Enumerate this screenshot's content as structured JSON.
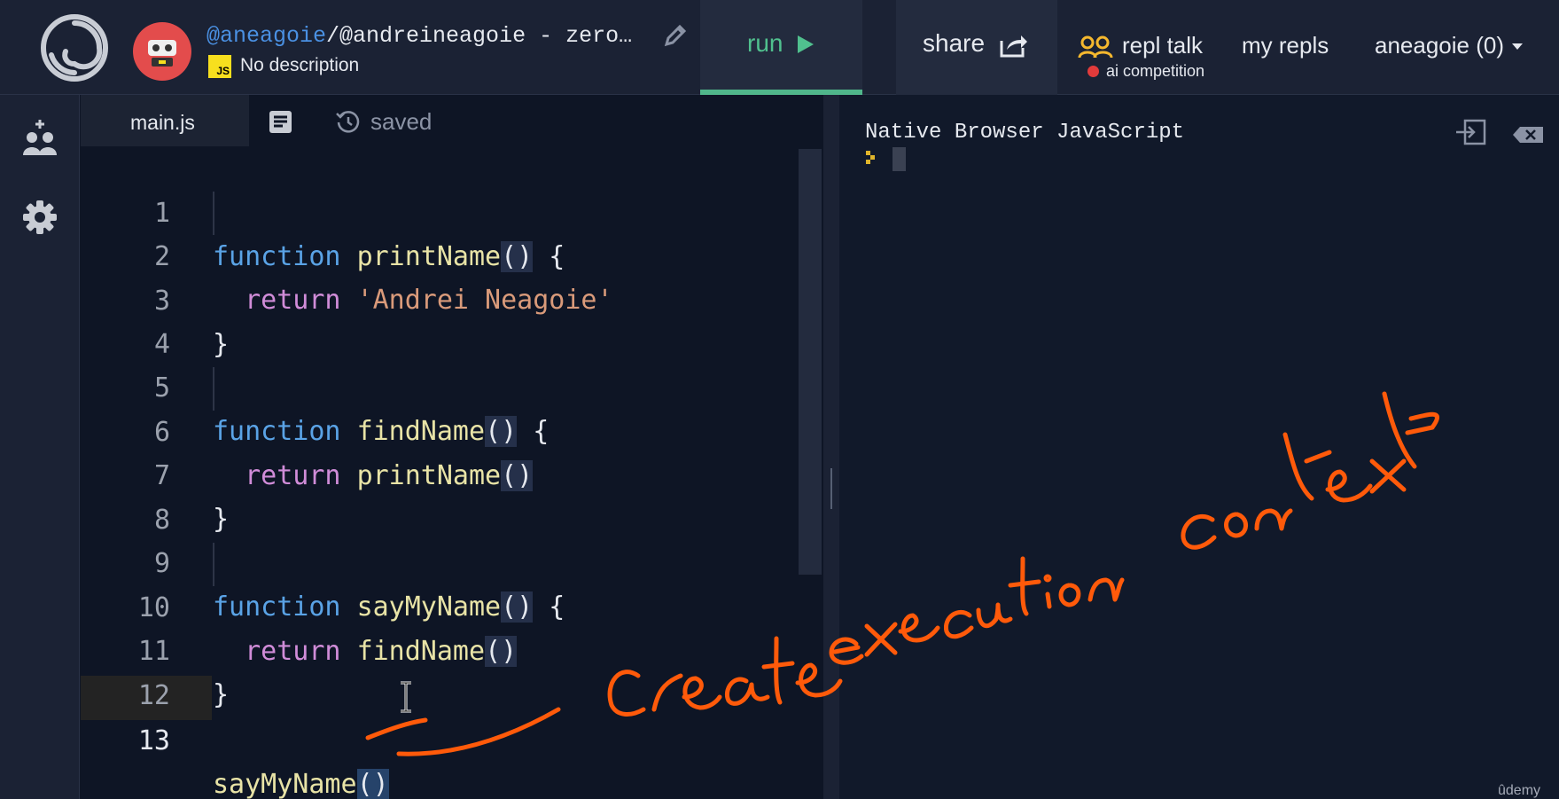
{
  "header": {
    "repl_user": "@aneagoie",
    "repl_path_rest": "/@andreineagoie - zero…",
    "language_badge": "JS",
    "description": "No description",
    "run_label": "run",
    "share_label": "share",
    "repl_talk_label": "repl talk",
    "competition_label": "ai competition",
    "my_repls_label": "my repls",
    "account_label": "aneagoie (0)"
  },
  "editor": {
    "active_file": "main.js",
    "save_status": "saved",
    "lines": [
      {
        "n": "1"
      },
      {
        "n": "2"
      },
      {
        "n": "3"
      },
      {
        "n": "4"
      },
      {
        "n": "5"
      },
      {
        "n": "6"
      },
      {
        "n": "7"
      },
      {
        "n": "8"
      },
      {
        "n": "9"
      },
      {
        "n": "10"
      },
      {
        "n": "11"
      },
      {
        "n": "12"
      },
      {
        "n": "13"
      }
    ],
    "tokens": {
      "kw_function": "function",
      "kw_return": "return",
      "fn_print": "printName",
      "fn_find": "findName",
      "fn_say": "sayMyName",
      "parens": "()",
      "open_brace": " {",
      "close_brace": "}",
      "string_name": "'Andrei Neagoie'"
    }
  },
  "console": {
    "title": "Native Browser JavaScript"
  },
  "annotation_text": "create execution context",
  "watermark": "ûdemy",
  "colors": {
    "background": "#0e1525",
    "header": "#1b2234",
    "run_green": "#50c08e",
    "annotation_orange": "#ff5a0a",
    "keyword_blue": "#5aa3e6",
    "return_pink": "#d08cd8",
    "function_yellow": "#e8e3a6",
    "string_orange": "#d99a7a"
  }
}
